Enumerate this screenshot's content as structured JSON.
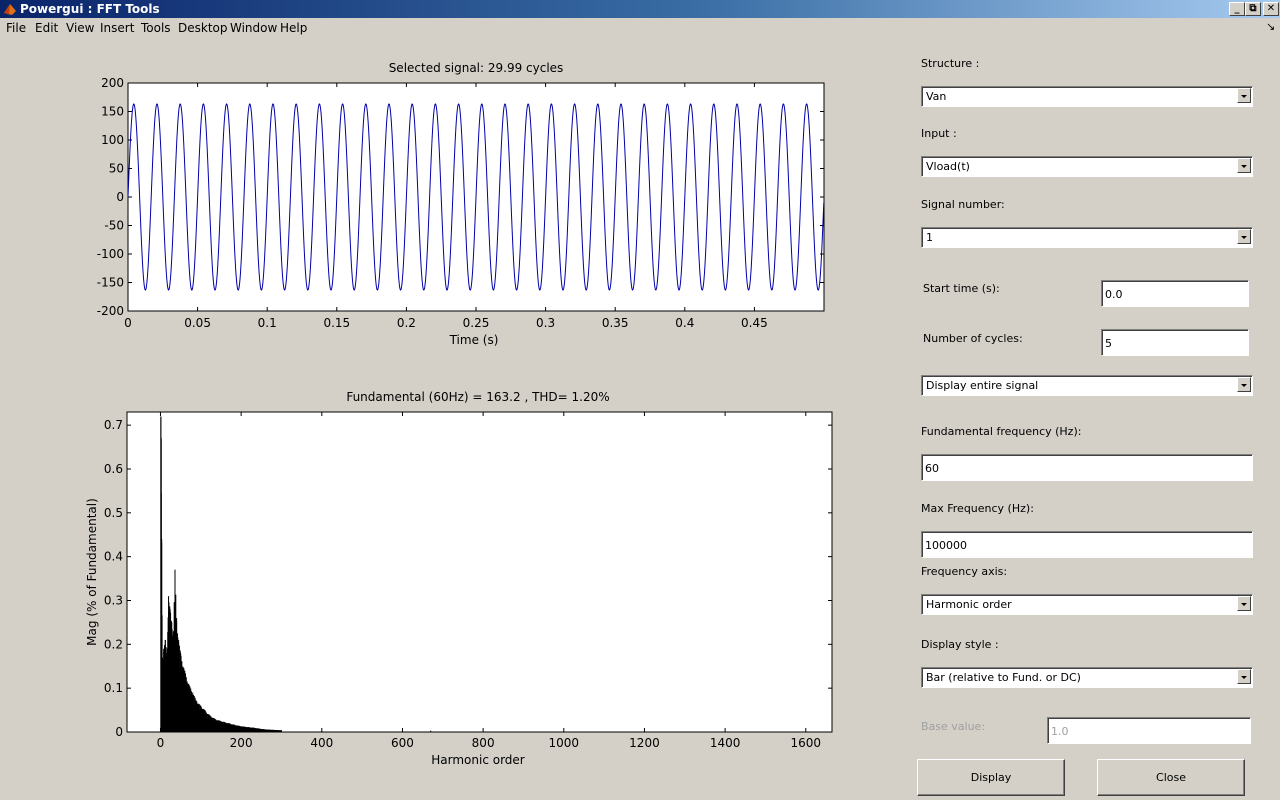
{
  "window": {
    "title": "Powergui : FFT Tools"
  },
  "menu": [
    "File",
    "Edit",
    "View",
    "Insert",
    "Tools",
    "Desktop",
    "Window",
    "Help"
  ],
  "chart_data": [
    {
      "type": "line",
      "title": "Selected signal: 29.99 cycles",
      "xlabel": "Time (s)",
      "ylabel": "",
      "xlim": [
        0,
        0.5
      ],
      "ylim": [
        -200,
        200
      ],
      "xticks": [
        "0",
        "0.05",
        "0.1",
        "0.15",
        "0.2",
        "0.25",
        "0.3",
        "0.35",
        "0.4",
        "0.45"
      ],
      "yticks": [
        "200",
        "150",
        "100",
        "50",
        "0",
        "-50",
        "-100",
        "-150",
        "-200"
      ],
      "series": [
        {
          "amplitude": 163.2,
          "frequency_hz": 60,
          "cycles": 29.99,
          "color": "#0000aa"
        }
      ]
    },
    {
      "type": "bar",
      "title": "Fundamental (60Hz) = 163.2 , THD= 1.20%",
      "xlabel": "Harmonic order",
      "ylabel": "Mag (% of Fundamental)",
      "xlim": [
        -83,
        1665
      ],
      "ylim": [
        0,
        0.73
      ],
      "xticks": [
        "0",
        "200",
        "400",
        "600",
        "800",
        "1000",
        "1200",
        "1400",
        "1600"
      ],
      "yticks": [
        "0.7",
        "0.6",
        "0.5",
        "0.4",
        "0.3",
        "0.2",
        "0.1",
        "0"
      ],
      "values": [
        [
          1,
          0.72
        ],
        [
          2,
          0.67
        ],
        [
          3,
          0.44
        ],
        [
          5,
          0.17
        ],
        [
          8,
          0.19
        ],
        [
          12,
          0.21
        ],
        [
          16,
          0.18
        ],
        [
          20,
          0.31
        ],
        [
          24,
          0.28
        ],
        [
          28,
          0.25
        ],
        [
          32,
          0.23
        ],
        [
          36,
          0.37
        ],
        [
          40,
          0.26
        ],
        [
          45,
          0.21
        ],
        [
          50,
          0.18
        ],
        [
          60,
          0.14
        ],
        [
          70,
          0.11
        ],
        [
          80,
          0.09
        ],
        [
          90,
          0.07
        ],
        [
          100,
          0.06
        ],
        [
          110,
          0.05
        ],
        [
          120,
          0.04
        ],
        [
          135,
          0.03
        ],
        [
          150,
          0.025
        ],
        [
          170,
          0.02
        ],
        [
          190,
          0.015
        ],
        [
          210,
          0.012
        ],
        [
          230,
          0.01
        ],
        [
          260,
          0.006
        ],
        [
          300,
          0.004
        ],
        [
          400,
          0.002
        ],
        [
          600,
          0.002
        ],
        [
          670,
          0.003
        ],
        [
          800,
          0.001
        ],
        [
          1000,
          0.001
        ]
      ]
    }
  ],
  "panel": {
    "structure_label": "Structure :",
    "structure_value": "Van",
    "input_label": "Input :",
    "input_value": "Vload(t)",
    "signal_label": "Signal number:",
    "signal_value": "1",
    "start_label": "Start time (s):",
    "start_value": "0.0",
    "cycles_label": "Number of cycles:",
    "cycles_value": "5",
    "display_mode_value": "Display entire signal",
    "fund_label": "Fundamental frequency (Hz):",
    "fund_value": "60",
    "maxf_label": "Max Frequency (Hz):",
    "maxf_value": "100000",
    "faxis_label": "Frequency axis:",
    "faxis_value": "Harmonic order",
    "style_label": "Display style :",
    "style_value": "Bar (relative to Fund. or DC)",
    "base_label": "Base value:",
    "base_value": "1.0",
    "display_button": "Display",
    "close_button": "Close"
  }
}
